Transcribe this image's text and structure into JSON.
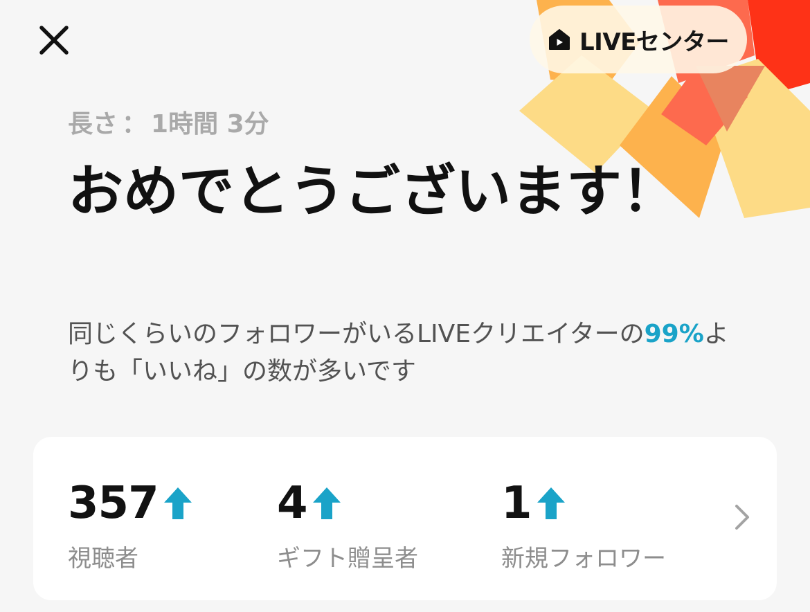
{
  "header": {
    "close_icon": "close-icon",
    "live_center": {
      "icon": "live-home-icon",
      "label": "LIVEセンター"
    }
  },
  "summary": {
    "duration_label": "長さ",
    "duration_separator": "：",
    "duration_value": "1時間 3分",
    "title": "おめでとうございます！",
    "comparison_prefix": "同じくらいのフォロワーがいるLIVEクリエイターの",
    "comparison_percent": "99%",
    "comparison_suffix": "よりも「いいね」の数が多いです"
  },
  "stats": {
    "items": [
      {
        "value": "357",
        "label": "視聴者",
        "trend": "up"
      },
      {
        "value": "4",
        "label": "ギフト贈呈者",
        "trend": "up"
      },
      {
        "value": "1",
        "label": "新規フォロワー",
        "trend": "up"
      }
    ],
    "arrow_icon": "chevron-right-icon"
  },
  "colors": {
    "accent": "#1aa3c8",
    "background": "#f6f6f6",
    "card": "#ffffff",
    "burst_yellow": "#fddb86",
    "burst_orange": "#fdb24d",
    "burst_red": "#fd6a4e",
    "burst_deep_red": "#fe3217"
  }
}
